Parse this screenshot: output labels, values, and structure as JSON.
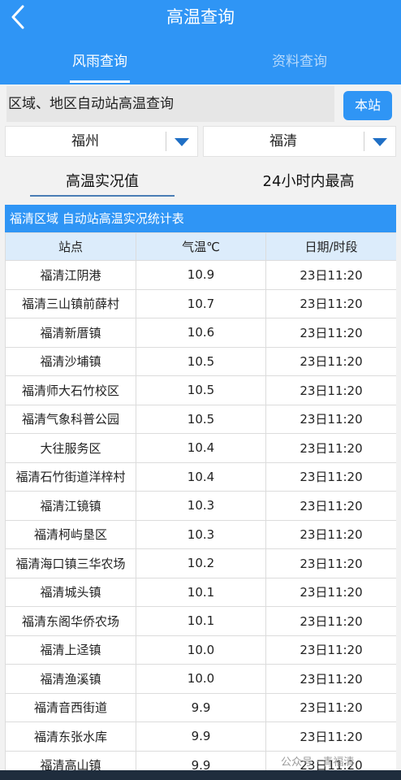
{
  "header": {
    "title": "高温查询",
    "tabs": [
      {
        "label": "风雨查询",
        "active": true
      },
      {
        "label": "资料查询",
        "active": false
      }
    ],
    "accent_color": "#2f95f5"
  },
  "query": {
    "label": "区域、地区自动站高温查询",
    "station_button": "本站"
  },
  "filters": {
    "city": "福州",
    "district": "福清"
  },
  "subtabs": [
    {
      "label": "高温实况值",
      "active": true
    },
    {
      "label": "24小时内最高",
      "active": false
    }
  ],
  "table": {
    "caption": "福清区域 自动站高温实况统计表",
    "columns": [
      "站点",
      "气温℃",
      "日期/时段"
    ],
    "rows": [
      [
        "福清江阴港",
        "10.9",
        "23日11:20"
      ],
      [
        "福清三山镇前薛村",
        "10.7",
        "23日11:20"
      ],
      [
        "福清新厝镇",
        "10.6",
        "23日11:20"
      ],
      [
        "福清沙埔镇",
        "10.5",
        "23日11:20"
      ],
      [
        "福清师大石竹校区",
        "10.5",
        "23日11:20"
      ],
      [
        "福清气象科普公园",
        "10.5",
        "23日11:20"
      ],
      [
        "大往服务区",
        "10.4",
        "23日11:20"
      ],
      [
        "福清石竹街道洋梓村",
        "10.4",
        "23日11:20"
      ],
      [
        "福清江镜镇",
        "10.3",
        "23日11:20"
      ],
      [
        "福清柯屿垦区",
        "10.3",
        "23日11:20"
      ],
      [
        "福清海口镇三华农场",
        "10.2",
        "23日11:20"
      ],
      [
        "福清城头镇",
        "10.1",
        "23日11:20"
      ],
      [
        "福清东阁华侨农场",
        "10.1",
        "23日11:20"
      ],
      [
        "福清上迳镇",
        "10.0",
        "23日11:20"
      ],
      [
        "福清渔溪镇",
        "10.0",
        "23日11:20"
      ],
      [
        "福清音西街道",
        "9.9",
        "23日11:20"
      ],
      [
        "福清东张水库",
        "9.9",
        "23日11:20"
      ],
      [
        "福清高山镇",
        "9.9",
        "23日11:20"
      ]
    ]
  },
  "watermark": "公众号 · 青福清",
  "icons": {
    "back": "chevron-left-icon",
    "dropdown": "triangle-down-icon"
  }
}
